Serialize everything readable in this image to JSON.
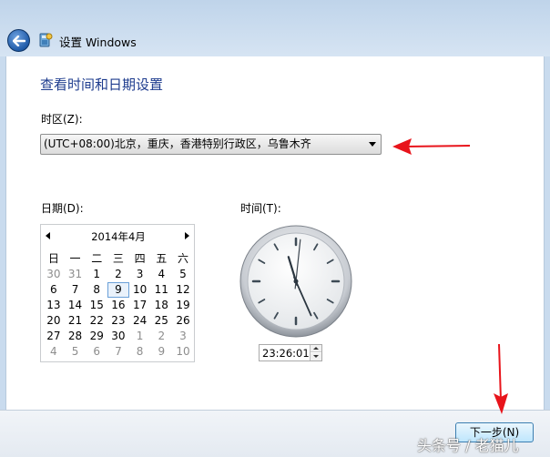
{
  "window": {
    "title": "设置 Windows"
  },
  "page": {
    "heading": "查看时间和日期设置"
  },
  "timezone": {
    "label": "时区(Z):",
    "value": "(UTC+08:00)北京，重庆，香港特别行政区，乌鲁木齐"
  },
  "date": {
    "label": "日期(D):",
    "month_title": "2014年4月",
    "weekdays": [
      "日",
      "一",
      "二",
      "三",
      "四",
      "五",
      "六"
    ],
    "weeks": [
      [
        {
          "d": "30",
          "m": true
        },
        {
          "d": "31",
          "m": true
        },
        {
          "d": "1"
        },
        {
          "d": "2"
        },
        {
          "d": "3"
        },
        {
          "d": "4"
        },
        {
          "d": "5"
        }
      ],
      [
        {
          "d": "6"
        },
        {
          "d": "7"
        },
        {
          "d": "8"
        },
        {
          "d": "9",
          "sel": true
        },
        {
          "d": "10"
        },
        {
          "d": "11"
        },
        {
          "d": "12"
        }
      ],
      [
        {
          "d": "13"
        },
        {
          "d": "14"
        },
        {
          "d": "15"
        },
        {
          "d": "16"
        },
        {
          "d": "17"
        },
        {
          "d": "18"
        },
        {
          "d": "19"
        }
      ],
      [
        {
          "d": "20"
        },
        {
          "d": "21"
        },
        {
          "d": "22"
        },
        {
          "d": "23"
        },
        {
          "d": "24"
        },
        {
          "d": "25"
        },
        {
          "d": "26"
        }
      ],
      [
        {
          "d": "27"
        },
        {
          "d": "28"
        },
        {
          "d": "29"
        },
        {
          "d": "30"
        },
        {
          "d": "1",
          "m": true
        },
        {
          "d": "2",
          "m": true
        },
        {
          "d": "3",
          "m": true
        }
      ],
      [
        {
          "d": "4",
          "m": true
        },
        {
          "d": "5",
          "m": true
        },
        {
          "d": "6",
          "m": true
        },
        {
          "d": "7",
          "m": true
        },
        {
          "d": "8",
          "m": true
        },
        {
          "d": "9",
          "m": true
        },
        {
          "d": "10",
          "m": true
        }
      ]
    ]
  },
  "time": {
    "label": "时间(T):",
    "value": "23:26:01",
    "hour": 23,
    "minute": 26,
    "second": 1
  },
  "footer": {
    "next_label": "下一步(N)"
  },
  "watermark": "头条号 / 老猫儿",
  "colors": {
    "heading": "#1e3c8e",
    "annotation_arrow": "#e8141b"
  },
  "icons": {
    "back": "back-arrow-icon",
    "app": "setup-icon",
    "dropdown": "chevron-down-icon"
  }
}
